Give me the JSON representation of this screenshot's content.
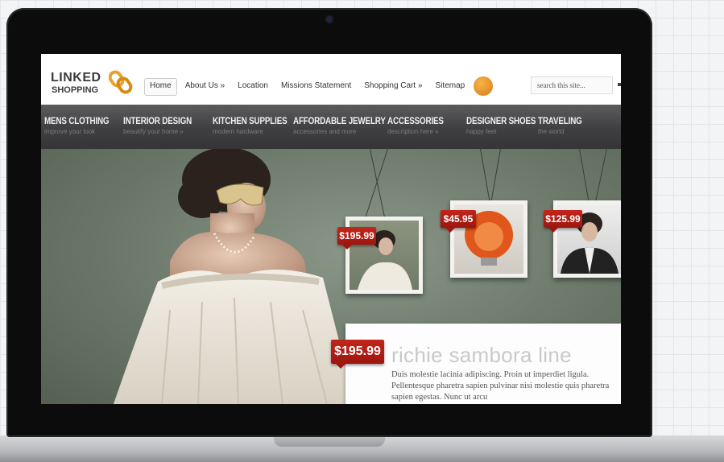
{
  "site": {
    "logo_line1": "LINKED",
    "logo_line2": "SHOPPING"
  },
  "topnav": [
    {
      "label": "Home",
      "active": true
    },
    {
      "label": "About Us »"
    },
    {
      "label": "Location"
    },
    {
      "label": "Missions Statement"
    },
    {
      "label": "Shopping Cart »"
    },
    {
      "label": "Sitemap"
    }
  ],
  "search": {
    "value": "search this site..."
  },
  "categories": [
    {
      "title": "MENS CLOTHING",
      "subtitle": "improve your look"
    },
    {
      "title": "INTERIOR DESIGN",
      "subtitle": "beautify your home »"
    },
    {
      "title": "KITCHEN SUPPLIES",
      "subtitle": "modern hardware"
    },
    {
      "title": "AFFORDABLE JEWELRY",
      "subtitle": "accessories and more"
    },
    {
      "title": "ACCESSORIES",
      "subtitle": "description here »"
    },
    {
      "title": "DESIGNER SHOES",
      "subtitle": "happy feet"
    },
    {
      "title": "TRAVELING",
      "subtitle": "the world"
    }
  ],
  "hero": {
    "frames": [
      {
        "price": "$195.99"
      },
      {
        "price": "$45.95"
      },
      {
        "price": "$125.99"
      }
    ],
    "feature": {
      "price": "$195.99",
      "title": "richie sambora line",
      "body": "Duis molestie lacinia adipiscing. Proin ut imperdiet ligula. Pellentesque pharetra sapien pulvinar nisi molestie quis pharetra sapien egestas. Nunc ut arcu"
    }
  },
  "colors": {
    "price_red": "#b41e16",
    "nav_dark": "#404042",
    "hero_green": "#7b887a"
  }
}
